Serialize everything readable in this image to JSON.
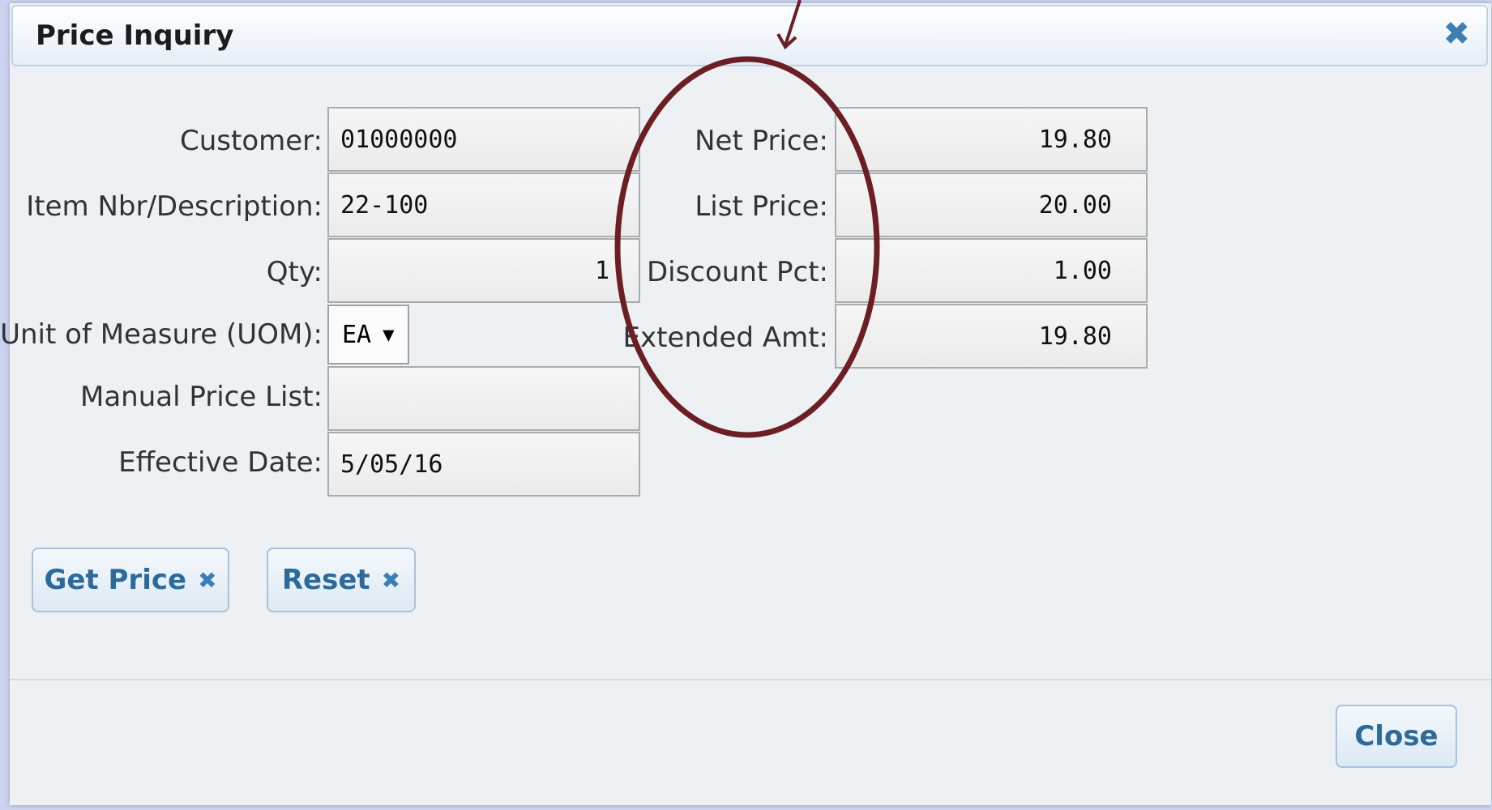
{
  "dialog": {
    "title": "Price Inquiry",
    "close_icon": "close-icon"
  },
  "form": {
    "customer": {
      "label": "Customer:",
      "value": "01000000"
    },
    "item": {
      "label": "Item Nbr/Description:",
      "value": "22-100"
    },
    "qty": {
      "label": "Qty:",
      "value": "1"
    },
    "uom": {
      "label": "Unit of Measure (UOM):",
      "value": "EA",
      "arrow": "▼"
    },
    "manual_price_list": {
      "label": "Manual Price List:",
      "value": ""
    },
    "effective_date": {
      "label": "Effective Date:",
      "value": "5/05/16"
    }
  },
  "pricing": {
    "net_price": {
      "label": "Net Price:",
      "value": "19.80"
    },
    "list_price": {
      "label": "List Price:",
      "value": "20.00"
    },
    "discount_pct": {
      "label": "Discount Pct:",
      "value": "1.00"
    },
    "extended_amt": {
      "label": "Extended Amt:",
      "value": "19.80"
    }
  },
  "buttons": {
    "get_price": "Get Price",
    "reset": "Reset",
    "close": "Close",
    "x_glyph": "✖"
  },
  "annotation": {
    "color": "#6b1f24"
  }
}
